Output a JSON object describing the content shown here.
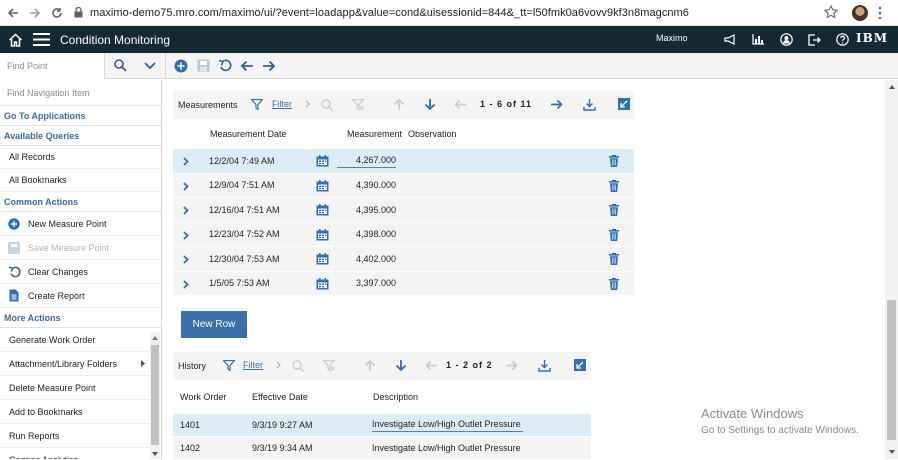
{
  "browser": {
    "url": "maximo-demo75.mro.com/maximo/ui/?event=loadapp&value=cond&uisessionid=844&_tt=l50fmk0a6vovv9kf3n8magcnm6"
  },
  "header": {
    "app_title": "Condition Monitoring",
    "user": "Maximo",
    "brand": "IBM",
    "bg_color": "#152935"
  },
  "toolbar": {
    "find_placeholder": "Find Point"
  },
  "sidebar": {
    "find_nav_placeholder": "Find Navigation Item",
    "go_to_apps": "Go To Applications",
    "available_queries_title": "Available Queries",
    "queries": [
      "All Records",
      "All Bookmarks"
    ],
    "common_actions_title": "Common Actions",
    "common_actions": [
      {
        "label": "New Measure Point",
        "icon": "plus-circle-icon"
      },
      {
        "label": "Save Measure Point",
        "icon": "save-icon"
      },
      {
        "label": "Clear Changes",
        "icon": "undo-icon"
      },
      {
        "label": "Create Report",
        "icon": "report-icon"
      }
    ],
    "more_actions_title": "More Actions",
    "more_actions": [
      "Generate Work Order",
      "Attachment/Library Folders",
      "Delete Measure Point",
      "Add to Bookmarks",
      "Run Reports",
      "Cognos Analytics"
    ]
  },
  "measurements": {
    "title": "Measurements",
    "filter": "Filter",
    "paging": "1 - 6 of 11",
    "columns": {
      "date": "Measurement Date",
      "measurement": "Measurement",
      "observation": "Observation"
    },
    "rows": [
      {
        "date": "12/2/04 7:49 AM",
        "value": "4,267.000"
      },
      {
        "date": "12/9/04 7:51 AM",
        "value": "4,390.000"
      },
      {
        "date": "12/16/04 7:51 AM",
        "value": "4,395.000"
      },
      {
        "date": "12/23/04 7:52 AM",
        "value": "4,398.000"
      },
      {
        "date": "12/30/04 7:53 AM",
        "value": "4,402.000"
      },
      {
        "date": "1/5/05 7:53 AM",
        "value": "3,397.000"
      }
    ],
    "new_row": "New Row"
  },
  "history": {
    "title": "History",
    "filter": "Filter",
    "paging": "1 - 2 of 2",
    "columns": {
      "wo": "Work Order",
      "date": "Effective Date",
      "desc": "Description"
    },
    "rows": [
      {
        "wo": "1401",
        "date": "9/3/19 9:27 AM",
        "desc": "Investigate Low/High Outlet Pressure"
      },
      {
        "wo": "1402",
        "date": "9/3/19 9:34 AM",
        "desc": "Investigate Low/High Outlet Pressure"
      }
    ]
  },
  "watermark": {
    "line1": "Activate Windows",
    "line2": "Go to Settings to activate Windows."
  },
  "colors": {
    "accent": "#3a6fa8",
    "link": "#3c6d9a",
    "selected_row": "#dcecf5"
  }
}
